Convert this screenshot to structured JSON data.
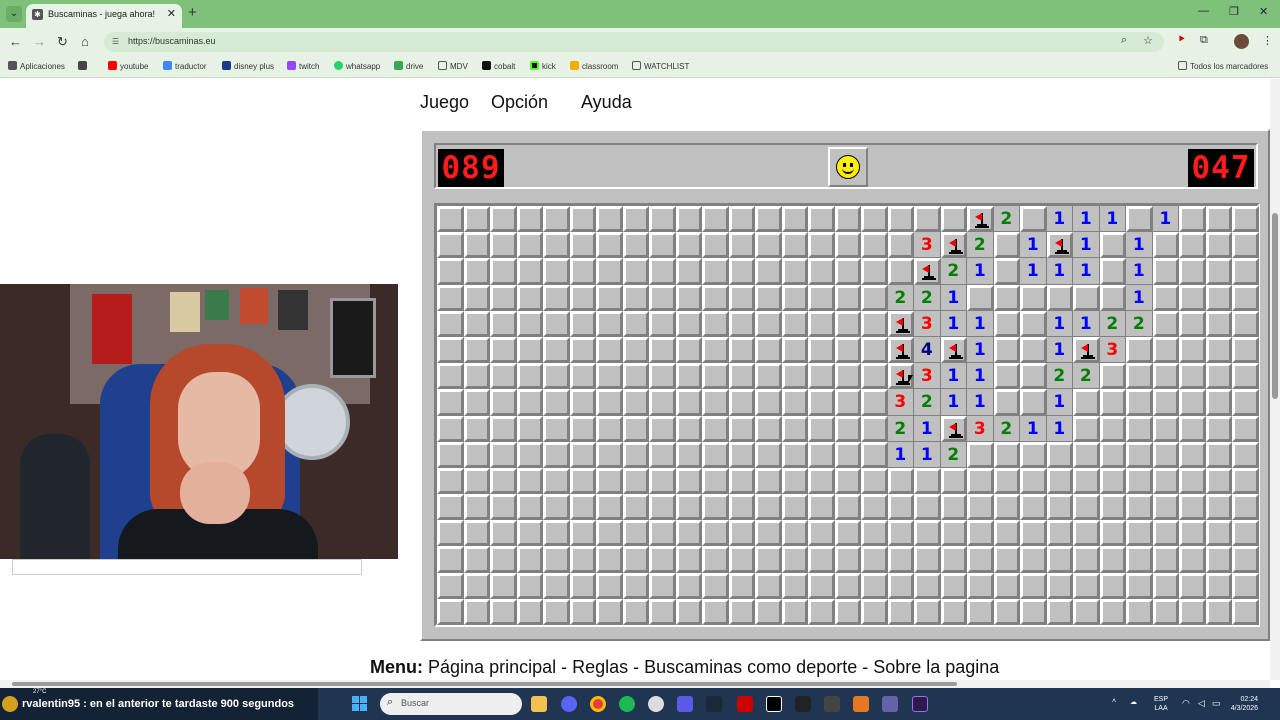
{
  "browser": {
    "tab_title": "Buscaminas - juega ahora!",
    "url": "https://buscaminas.eu",
    "bookmarks": [
      {
        "label": "Aplicaciones",
        "color": "#555555"
      },
      {
        "label": "youtube",
        "color": "#ff0000"
      },
      {
        "label": "traductor",
        "color": "#4285f4"
      },
      {
        "label": "disney plus",
        "color": "#1b3a8a"
      },
      {
        "label": "twitch",
        "color": "#9146ff"
      },
      {
        "label": "whatsapp",
        "color": "#25d366"
      },
      {
        "label": "drive",
        "color": "#34a853"
      },
      {
        "label": "MDV",
        "color": "#777777"
      },
      {
        "label": "cobalt",
        "color": "#111111"
      },
      {
        "label": "kick",
        "color": "#53fc18"
      },
      {
        "label": "classroom",
        "color": "#f9ab00"
      },
      {
        "label": "WATCHLIST",
        "color": "#777777"
      }
    ],
    "all_bookmarks": "Todos los marcadores"
  },
  "game": {
    "menu": [
      "Juego",
      "Opción",
      "Ayuda"
    ],
    "mine_counter": "089",
    "timer": "047",
    "face": "smiley",
    "rows": [
      "..................F2.111.1...",
      "................3F2.1F1.1....",
      "................F21.111.1....",
      "...............221......1....",
      "...............F311..1122....",
      "...............F4F1..1F3.....",
      "...............F311..22......",
      "...............3211..1.......",
      "...............21F3211.......",
      "...............112...........",
      ".............................",
      ".............................",
      ".............................",
      ".............................",
      ".............................",
      "............................."
    ]
  },
  "footer": {
    "menu_label": "Menu:",
    "links": "Página principal - Reglas - Buscaminas como deporte - Sobre la pagina"
  },
  "taskbar": {
    "chat_message": "rvalentin95 : en el anterior te tardaste 900 segundos",
    "weather": "27°C",
    "search_placeholder": "Buscar",
    "lang_top": "ESP",
    "lang_bottom": "LAA",
    "time": "02:24",
    "date": "4/3/2026"
  }
}
